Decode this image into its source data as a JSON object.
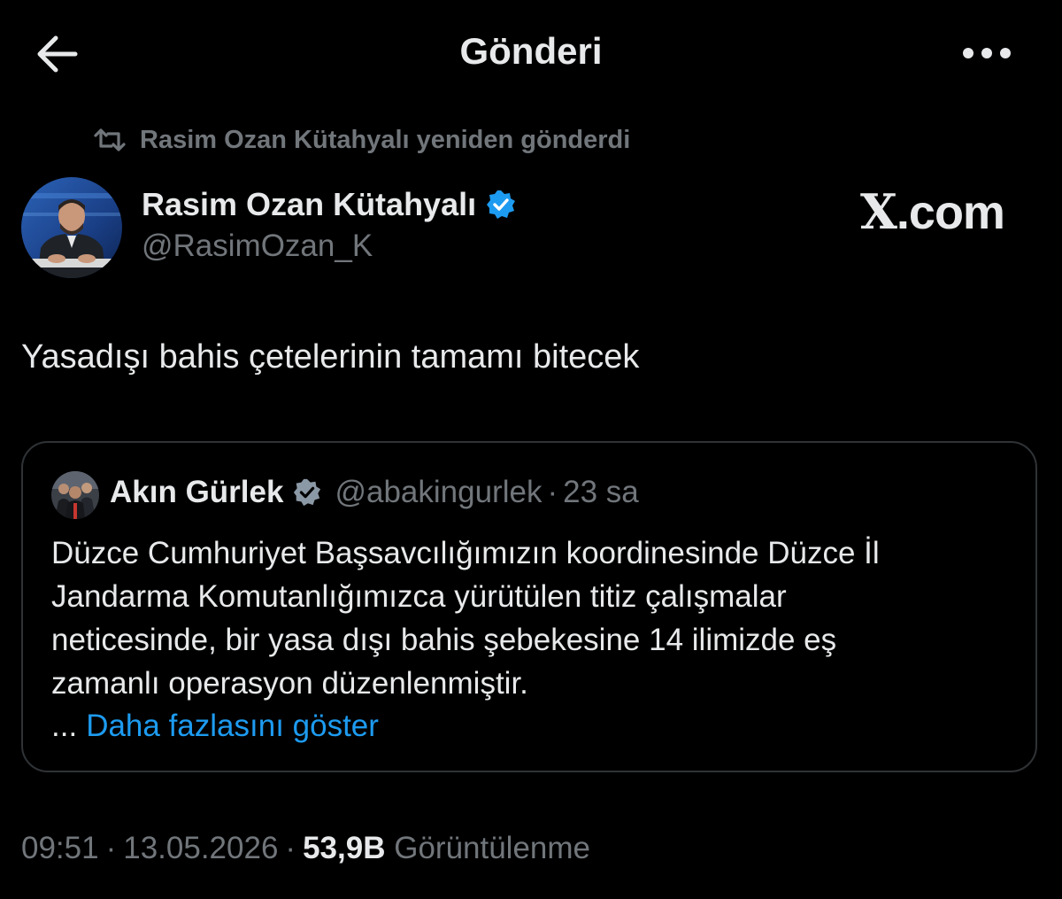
{
  "header": {
    "title": "Gönderi",
    "back_icon": "arrow-left-icon",
    "more_icon": "more-horizontal-icon"
  },
  "repost": {
    "text": "Rasim Ozan Kütahyalı yeniden gönderdi",
    "icon": "repost-icon"
  },
  "post": {
    "author_name": "Rasim Ozan Kütahyalı",
    "author_handle": "@RasimOzan_K",
    "verified_icon": "verified-badge-icon",
    "text": "Yasadışı bahis çetelerinin tamamı bitecek"
  },
  "watermark": {
    "x": "X",
    "rest": ".com"
  },
  "quote": {
    "author_name": "Akın Gürlek",
    "author_handle": "@abakingurlek",
    "separator": "·",
    "time": "23 sa",
    "lines": [
      "Düzce Cumhuriyet Başsavcılığımızın koordinesinde Düzce İl",
      "Jandarma Komutanlığımızca yürütülen titiz çalışmalar",
      "neticesinde, bir yasa dışı bahis şebekesine 14 ilimizde eş",
      "zamanlı operasyon düzenlenmiştir."
    ],
    "ellipsis": "...",
    "show_more": "Daha fazlasını göster"
  },
  "meta": {
    "time": "09:51",
    "date": "13.05.2026",
    "separator": "·",
    "views_count": "53,9B",
    "views_label": "Görüntülenme"
  },
  "colors": {
    "background": "#000000",
    "text": "#e7e9ea",
    "muted": "#71767b",
    "accent": "#1d9bf0",
    "border": "#2f3336"
  }
}
